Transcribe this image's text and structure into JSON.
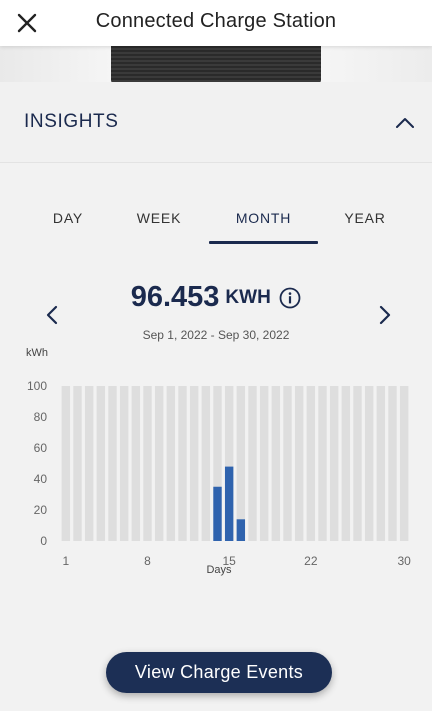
{
  "header": {
    "title": "Connected Charge Station"
  },
  "icons": {
    "close": "close-icon",
    "collapse": "chevron-up-icon",
    "prev": "chevron-left-icon",
    "next": "chevron-right-icon",
    "info": "info-icon"
  },
  "insights": {
    "title": "INSIGHTS"
  },
  "tabs": [
    {
      "label": "DAY"
    },
    {
      "label": "WEEK"
    },
    {
      "label": "MONTH",
      "active": true
    },
    {
      "label": "YEAR"
    }
  ],
  "summary": {
    "value": "96.453",
    "unit": "KWH",
    "date_range": "Sep 1, 2022 - Sep 30, 2022"
  },
  "colors": {
    "accent": "#1b2a4e",
    "bar": "#2f63ae",
    "bar_bg": "#dedede",
    "button": "#1c2f55"
  },
  "chart_data": {
    "type": "bar",
    "ylabel": "kWh",
    "xlabel": "Days",
    "ylim": [
      0,
      100
    ],
    "yticks": [
      0,
      20,
      40,
      60,
      80,
      100
    ],
    "xticks": [
      1,
      8,
      15,
      22,
      30
    ],
    "x": [
      1,
      2,
      3,
      4,
      5,
      6,
      7,
      8,
      9,
      10,
      11,
      12,
      13,
      14,
      15,
      16,
      17,
      18,
      19,
      20,
      21,
      22,
      23,
      24,
      25,
      26,
      27,
      28,
      29,
      30
    ],
    "values": [
      0,
      0,
      0,
      0,
      0,
      0,
      0,
      0,
      0,
      0,
      0,
      0,
      0,
      35,
      48,
      14,
      0,
      0,
      0,
      0,
      0,
      0,
      0,
      0,
      0,
      0,
      0,
      0,
      0,
      0
    ],
    "grid": false
  },
  "cta": {
    "label": "View Charge Events"
  }
}
